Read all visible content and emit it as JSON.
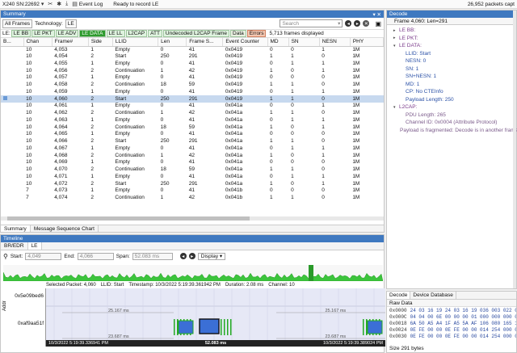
{
  "topbar": {
    "device": "X240 SN:22692",
    "event_log": "Event Log",
    "status": "Ready to record LE",
    "packets": "26,952 packets capt"
  },
  "summary": {
    "title": "Summary",
    "all_frames": "All Frames",
    "technology_label": "Technology:",
    "technology_value": "LE",
    "search_placeholder": "Search",
    "le_label": "LE:",
    "tags": [
      {
        "label": "LE BB",
        "style": "normal"
      },
      {
        "label": "LE PKT",
        "style": "normal"
      },
      {
        "label": "LE ADV",
        "style": "normal"
      },
      {
        "label": "LE DATA",
        "style": "active"
      },
      {
        "label": "LE LL",
        "style": "normal"
      },
      {
        "label": "L2CAP",
        "style": "normal"
      },
      {
        "label": "ATT",
        "style": "normal"
      },
      {
        "label": "Undecoded L2CAP Frame",
        "style": "normal"
      },
      {
        "label": "Data",
        "style": "data"
      },
      {
        "label": "Errors",
        "style": "err"
      }
    ],
    "frames_displayed": "5,713 frames displayed",
    "columns": [
      "B...",
      "Chan",
      "Frame#",
      "Side",
      "LLID",
      "Len",
      "Frame S...",
      "Event Counter",
      "MD",
      "SN",
      "NESN",
      "PHY"
    ],
    "rows": [
      [
        "10",
        "4,053",
        "1",
        "Empty",
        "0",
        "41",
        "0x0419",
        "0",
        "0",
        "1",
        "1M"
      ],
      [
        "10",
        "4,054",
        "2",
        "Start",
        "250",
        "291",
        "0x0419",
        "1",
        "1",
        "0",
        "1M"
      ],
      [
        "10",
        "4,055",
        "1",
        "Empty",
        "0",
        "41",
        "0x0419",
        "0",
        "1",
        "1",
        "1M"
      ],
      [
        "10",
        "4,056",
        "2",
        "Continuation",
        "1",
        "42",
        "0x0419",
        "1",
        "0",
        "1",
        "1M"
      ],
      [
        "10",
        "4,057",
        "1",
        "Empty",
        "0",
        "41",
        "0x0419",
        "0",
        "0",
        "0",
        "1M"
      ],
      [
        "10",
        "4,058",
        "2",
        "Continuation",
        "18",
        "59",
        "0x0419",
        "1",
        "1",
        "0",
        "1M"
      ],
      [
        "10",
        "4,059",
        "1",
        "Empty",
        "0",
        "41",
        "0x0419",
        "0",
        "1",
        "1",
        "1M"
      ],
      [
        "10",
        "4,060",
        "2",
        "Start",
        "250",
        "291",
        "0x0419",
        "1",
        "1",
        "0",
        "1M"
      ],
      [
        "10",
        "4,061",
        "1",
        "Empty",
        "0",
        "41",
        "0x041a",
        "0",
        "0",
        "1",
        "1M"
      ],
      [
        "10",
        "4,062",
        "2",
        "Continuation",
        "1",
        "42",
        "0x041a",
        "1",
        "1",
        "0",
        "1M"
      ],
      [
        "10",
        "4,063",
        "1",
        "Empty",
        "0",
        "41",
        "0x041a",
        "0",
        "1",
        "1",
        "1M"
      ],
      [
        "10",
        "4,064",
        "2",
        "Continuation",
        "18",
        "59",
        "0x041a",
        "1",
        "0",
        "1",
        "1M"
      ],
      [
        "10",
        "4,065",
        "1",
        "Empty",
        "0",
        "41",
        "0x041a",
        "0",
        "0",
        "0",
        "1M"
      ],
      [
        "10",
        "4,066",
        "2",
        "Start",
        "250",
        "291",
        "0x041a",
        "1",
        "1",
        "0",
        "1M"
      ],
      [
        "10",
        "4,067",
        "1",
        "Empty",
        "0",
        "41",
        "0x041a",
        "0",
        "1",
        "1",
        "1M"
      ],
      [
        "10",
        "4,068",
        "2",
        "Continuation",
        "1",
        "42",
        "0x041a",
        "1",
        "0",
        "1",
        "1M"
      ],
      [
        "10",
        "4,069",
        "1",
        "Empty",
        "0",
        "41",
        "0x041a",
        "0",
        "0",
        "0",
        "1M"
      ],
      [
        "10",
        "4,070",
        "2",
        "Continuation",
        "18",
        "59",
        "0x041a",
        "1",
        "1",
        "0",
        "1M"
      ],
      [
        "10",
        "4,071",
        "1",
        "Empty",
        "0",
        "41",
        "0x041a",
        "0",
        "1",
        "1",
        "1M"
      ],
      [
        "10",
        "4,072",
        "2",
        "Start",
        "250",
        "291",
        "0x041a",
        "1",
        "0",
        "1",
        "1M"
      ],
      [
        "7",
        "4,073",
        "1",
        "Empty",
        "0",
        "41",
        "0x041b",
        "0",
        "0",
        "0",
        "1M"
      ],
      [
        "7",
        "4,074",
        "2",
        "Continuation",
        "1",
        "42",
        "0x041b",
        "1",
        "1",
        "0",
        "1M"
      ]
    ],
    "selected_row": 7,
    "bottom_tabs": [
      "Summary",
      "Message Sequence Chart"
    ]
  },
  "decode": {
    "title": "Decode",
    "header": "Frame 4,060: Len=291",
    "tree": [
      {
        "text": "LE BB:",
        "level": 0,
        "style": "purple",
        "tw": "▸"
      },
      {
        "text": "LE PKT:",
        "level": 0,
        "style": "purple",
        "tw": "▸"
      },
      {
        "text": "LE DATA:",
        "level": 0,
        "style": "purple",
        "tw": "▾"
      },
      {
        "text": "LLID: Start",
        "level": 1,
        "style": "blue",
        "tw": ""
      },
      {
        "text": "NESN: 0",
        "level": 1,
        "style": "blue",
        "tw": ""
      },
      {
        "text": "SN: 1",
        "level": 1,
        "style": "blue",
        "tw": ""
      },
      {
        "text": "SN+NESN: 1",
        "level": 1,
        "style": "blue",
        "tw": ""
      },
      {
        "text": "MD: 1",
        "level": 1,
        "style": "blue",
        "tw": ""
      },
      {
        "text": "CP: No CTEInfo",
        "level": 1,
        "style": "blue",
        "tw": ""
      },
      {
        "text": "Payload Length: 250",
        "level": 1,
        "style": "blue",
        "tw": ""
      },
      {
        "text": "L2CAP:",
        "level": 0,
        "style": "purple",
        "tw": "▾"
      },
      {
        "text": "PDU Length: 265",
        "level": 1,
        "style": "muted",
        "tw": ""
      },
      {
        "text": "Channel ID: 0x0004  (Attribute Protocol)",
        "level": 1,
        "style": "muted",
        "tw": ""
      },
      {
        "text": "Payload is fragmented: Decode is in another frame",
        "level": 1,
        "style": "muted",
        "tw": ""
      }
    ]
  },
  "raw": {
    "tabs": [
      "Decode",
      "Device Database"
    ],
    "title": "Raw Data",
    "rows": [
      {
        "off": "0x0000",
        "hex": "24 03 16 19 24 03 16 19 036 003 022 025"
      },
      {
        "off": "0x000C",
        "hex": "04 04 00 6E 00 00 00 01 000 000 000 001"
      },
      {
        "off": "0x0018",
        "hex": "6A 50 A5 A4 1F A5 5A AF 106 080 165 164"
      },
      {
        "off": "0x0024",
        "hex": "0E FE 00 00 0E FE 00 00 014 254 000 000"
      },
      {
        "off": "0x0030",
        "hex": "0E FE 00 00 0E FE 00 00 014 254 000 000"
      }
    ],
    "size": "Size 291 bytes"
  },
  "timeline": {
    "title": "Timeline",
    "tabs": [
      "BR/EDR",
      "LE"
    ],
    "start_label": "Start:",
    "start_value": "4,049",
    "end_label": "End:",
    "end_value": "4,066",
    "span_label": "Span:",
    "span_value": "52.083 ms",
    "display": "Display",
    "info": {
      "selected": "Selected Packet: 4,060",
      "llid": "LLID: Start",
      "timestamp": "Timestamp: 10/3/2022 5:19:39.361942 PM",
      "duration": "Duration: 2.08 ms",
      "channel": "Channel: 10"
    },
    "axis_label": "Addr",
    "addresses": [
      "0x5e09bed6",
      "0xaf9aa51f"
    ],
    "gap_labels": [
      "25.167 ms",
      "25.167 ms",
      "23.687 ms",
      "23.687 ms"
    ],
    "footer_left": "10/3/2022 5:19:39.336941 PM",
    "footer_mid": "52.083 ms",
    "footer_right": "10/3/2022 5:19:39.389024 PM"
  }
}
